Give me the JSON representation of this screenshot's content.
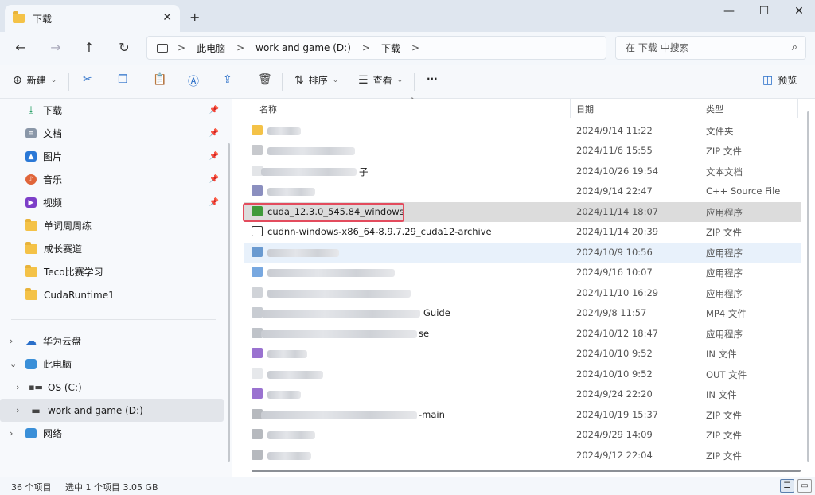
{
  "window": {
    "tab_title": "下载",
    "tab_close": "✕",
    "new_tab": "+",
    "minimize": "—",
    "maximize": "☐",
    "close": "✕"
  },
  "nav": {
    "back": "←",
    "forward": "→",
    "up": "↑",
    "refresh": "↻",
    "breadcrumbs": [
      "此电脑",
      "work and game  (D:)",
      "下载"
    ],
    "sep": ">",
    "search_placeholder": "在 下载 中搜索"
  },
  "toolbar": {
    "new_label": "新建",
    "sort_label": "排序",
    "view_label": "查看",
    "more_label": "···",
    "preview_label": "预览"
  },
  "sidebar": {
    "quick": [
      {
        "label": "下载",
        "icon": "download-icon",
        "pinned": true
      },
      {
        "label": "文档",
        "icon": "document-icon",
        "pinned": true
      },
      {
        "label": "图片",
        "icon": "pictures-icon",
        "pinned": true
      },
      {
        "label": "音乐",
        "icon": "music-icon",
        "pinned": true
      },
      {
        "label": "视频",
        "icon": "video-icon",
        "pinned": true
      },
      {
        "label": "单词周周练",
        "icon": "folder-icon",
        "pinned": false
      },
      {
        "label": "成长赛道",
        "icon": "folder-icon",
        "pinned": false
      },
      {
        "label": "Teco比赛学习",
        "icon": "folder-icon",
        "pinned": false
      },
      {
        "label": "CudaRuntime1",
        "icon": "folder-icon",
        "pinned": false
      }
    ],
    "tree": [
      {
        "label": "华为云盘",
        "icon": "cloud-icon"
      },
      {
        "label": "此电脑",
        "icon": "computer-icon"
      },
      {
        "label": "OS (C:)",
        "icon": "drive-c-icon"
      },
      {
        "label": "work and game  (D:)",
        "icon": "drive-d-icon"
      },
      {
        "label": "网络",
        "icon": "network-icon"
      }
    ]
  },
  "list": {
    "headers": {
      "name": "名称",
      "date": "日期",
      "type": "类型"
    },
    "rows": [
      {
        "name": "",
        "date": "2024/9/14 11:22",
        "type": "文件夹"
      },
      {
        "name": "",
        "date": "2024/11/6 15:55",
        "type": "ZIP 文件"
      },
      {
        "name": "子",
        "date": "2024/10/26 19:54",
        "type": "文本文档"
      },
      {
        "name": "",
        "date": "2024/9/14 22:47",
        "type": "C++ Source File"
      },
      {
        "name": "cuda_12.3.0_545.84_windows",
        "date": "2024/11/14 18:07",
        "type": "应用程序"
      },
      {
        "name": "cudnn-windows-x86_64-8.9.7.29_cuda12-archive",
        "date": "2024/11/14 20:39",
        "type": "ZIP 文件"
      },
      {
        "name": "",
        "date": "2024/10/9 10:56",
        "type": "应用程序"
      },
      {
        "name": "",
        "date": "2024/9/16 10:07",
        "type": "应用程序"
      },
      {
        "name": "",
        "date": "2024/11/10 16:29",
        "type": "应用程序"
      },
      {
        "name": "Guide",
        "date": "2024/9/8 11:57",
        "type": "MP4 文件"
      },
      {
        "name": "se",
        "date": "2024/10/12 18:47",
        "type": "应用程序"
      },
      {
        "name": "",
        "date": "2024/10/10 9:52",
        "type": "IN 文件"
      },
      {
        "name": "",
        "date": "2024/10/10 9:52",
        "type": "OUT 文件"
      },
      {
        "name": "",
        "date": "2024/9/24 22:20",
        "type": "IN 文件"
      },
      {
        "name": "-main",
        "date": "2024/10/19 15:37",
        "type": "ZIP 文件"
      },
      {
        "name": "",
        "date": "2024/9/29 14:09",
        "type": "ZIP 文件"
      },
      {
        "name": "",
        "date": "2024/9/12 22:04",
        "type": "ZIP 文件"
      }
    ]
  },
  "status": {
    "count": "36 个项目",
    "selection": "选中 1 个项目  3.05 GB"
  },
  "colors": {
    "accent": "#2a6fc9",
    "highlight_box": "#e34b5d",
    "folder": "#f4c247"
  }
}
